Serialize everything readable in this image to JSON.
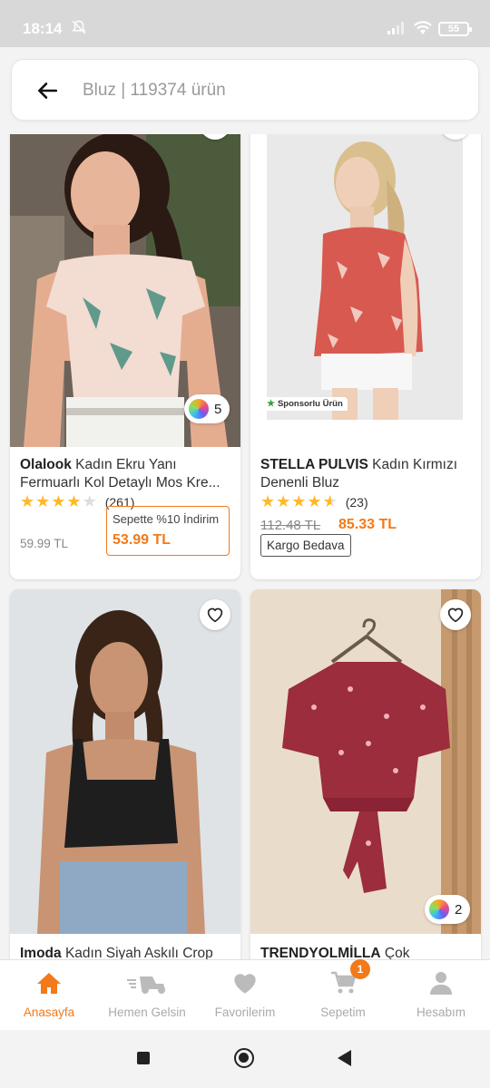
{
  "status_bar": {
    "time": "18:14",
    "battery": "55"
  },
  "search": {
    "text": "Bluz | 119374 ürün"
  },
  "products": [
    {
      "brand": "Olalook",
      "title_rest": " Kadın Ekru Yanı Fermuarlı Kol Detaylı Mos Kre...",
      "rating": 4,
      "review_count": "(261)",
      "variant_count": "5",
      "old_price": "59.99 TL",
      "basket_label": "Sepette %10 İndirim",
      "basket_price": "53.99 TL"
    },
    {
      "brand": "STELLA PULVIS",
      "title_rest": " Kadın Kırmızı Denenli  Bluz",
      "rating": 4.5,
      "review_count": "(23)",
      "sponsor": "Sponsorlu Ürün",
      "old_price": "112.48 TL",
      "new_price": "85.33 TL",
      "kargo": "Kargo Bedava"
    },
    {
      "brand": "Imoda",
      "title_rest": " Kadın Siyah Askılı Crop"
    },
    {
      "brand": "TRENDYOLMİLLA",
      "title_rest": " Çok",
      "variant_count": "2"
    }
  ],
  "bottom_nav": {
    "items": [
      {
        "label": "Anasayfa",
        "icon": "home-icon",
        "active": true
      },
      {
        "label": "Hemen Gelsin",
        "icon": "delivery-scooter-icon"
      },
      {
        "label": "Favorilerim",
        "icon": "heart-icon"
      },
      {
        "label": "Sepetim",
        "icon": "cart-icon"
      },
      {
        "label": "Hesabım",
        "icon": "user-icon"
      }
    ],
    "cart_badge": "1"
  },
  "colors": {
    "accent": "#f27a1a",
    "inactive": "#aaaaaa"
  }
}
